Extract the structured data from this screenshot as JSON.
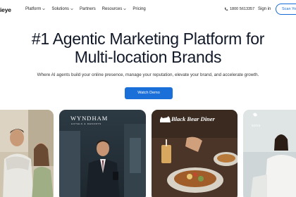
{
  "nav": {
    "logo": "ieye",
    "menu": [
      {
        "label": "Platform",
        "has_dropdown": true
      },
      {
        "label": "Solutions",
        "has_dropdown": true
      },
      {
        "label": "Partners",
        "has_dropdown": false
      },
      {
        "label": "Resources",
        "has_dropdown": true
      },
      {
        "label": "Pricing",
        "has_dropdown": false
      }
    ],
    "phone": "1800 5613357",
    "signin": "Sign in",
    "scan_button": "Scan You"
  },
  "hero": {
    "title_line1": "#1 Agentic Marketing Platform for",
    "title_line2": "Multi-location Brands",
    "subtitle": "Where AI agents build your online presence, manage your reputation, elevate your brand, and accelerate growth.",
    "cta": "Watch Demo"
  },
  "cards": {
    "wyndham": {
      "brand": "WYNDHAM",
      "sub": "HOTELS & RESORTS"
    },
    "blackbear": {
      "brand": "Black Bear Diner"
    },
    "sono": {
      "brand": "sono"
    }
  },
  "colors": {
    "accent": "#1b6fd8",
    "text": "#111827"
  }
}
